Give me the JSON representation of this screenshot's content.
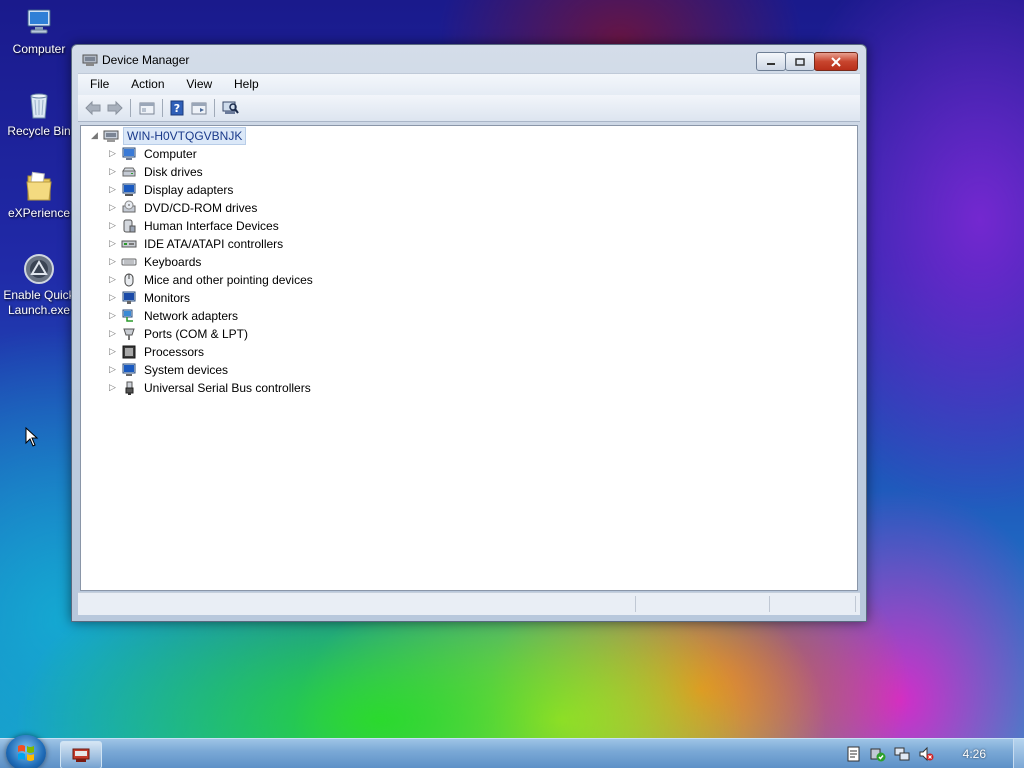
{
  "desktop": {
    "icons": [
      {
        "label": "Computer",
        "icon": "computer-icon"
      },
      {
        "label": "Recycle Bin",
        "icon": "recycle-bin-icon"
      },
      {
        "label": "eXPerience",
        "icon": "folder-icon"
      },
      {
        "label_line1": "Enable Quick",
        "label_line2": "Launch.exe",
        "icon": "app-icon"
      }
    ]
  },
  "window": {
    "title": "Device Manager",
    "menu": [
      "File",
      "Action",
      "View",
      "Help"
    ],
    "tree": {
      "root": "WIN-H0VTQGVBNJK",
      "items": [
        {
          "label": "Computer",
          "icon": "computer-icon"
        },
        {
          "label": "Disk drives",
          "icon": "disk-drive-icon"
        },
        {
          "label": "Display adapters",
          "icon": "display-adapter-icon"
        },
        {
          "label": "DVD/CD-ROM drives",
          "icon": "dvd-drive-icon"
        },
        {
          "label": "Human Interface Devices",
          "icon": "hid-icon"
        },
        {
          "label": "IDE ATA/ATAPI controllers",
          "icon": "ide-controller-icon"
        },
        {
          "label": "Keyboards",
          "icon": "keyboard-icon"
        },
        {
          "label": "Mice and other pointing devices",
          "icon": "mouse-icon"
        },
        {
          "label": "Monitors",
          "icon": "monitor-icon"
        },
        {
          "label": "Network adapters",
          "icon": "network-adapter-icon"
        },
        {
          "label": "Ports (COM & LPT)",
          "icon": "port-icon"
        },
        {
          "label": "Processors",
          "icon": "processor-icon"
        },
        {
          "label": "System devices",
          "icon": "system-device-icon"
        },
        {
          "label": "Universal Serial Bus controllers",
          "icon": "usb-icon"
        }
      ]
    }
  },
  "taskbar": {
    "clock": "4:26"
  },
  "colors": {
    "title_bg": "#c2cfe0",
    "selection": "#dbe8f8",
    "taskbar": "#7ba9d6"
  }
}
